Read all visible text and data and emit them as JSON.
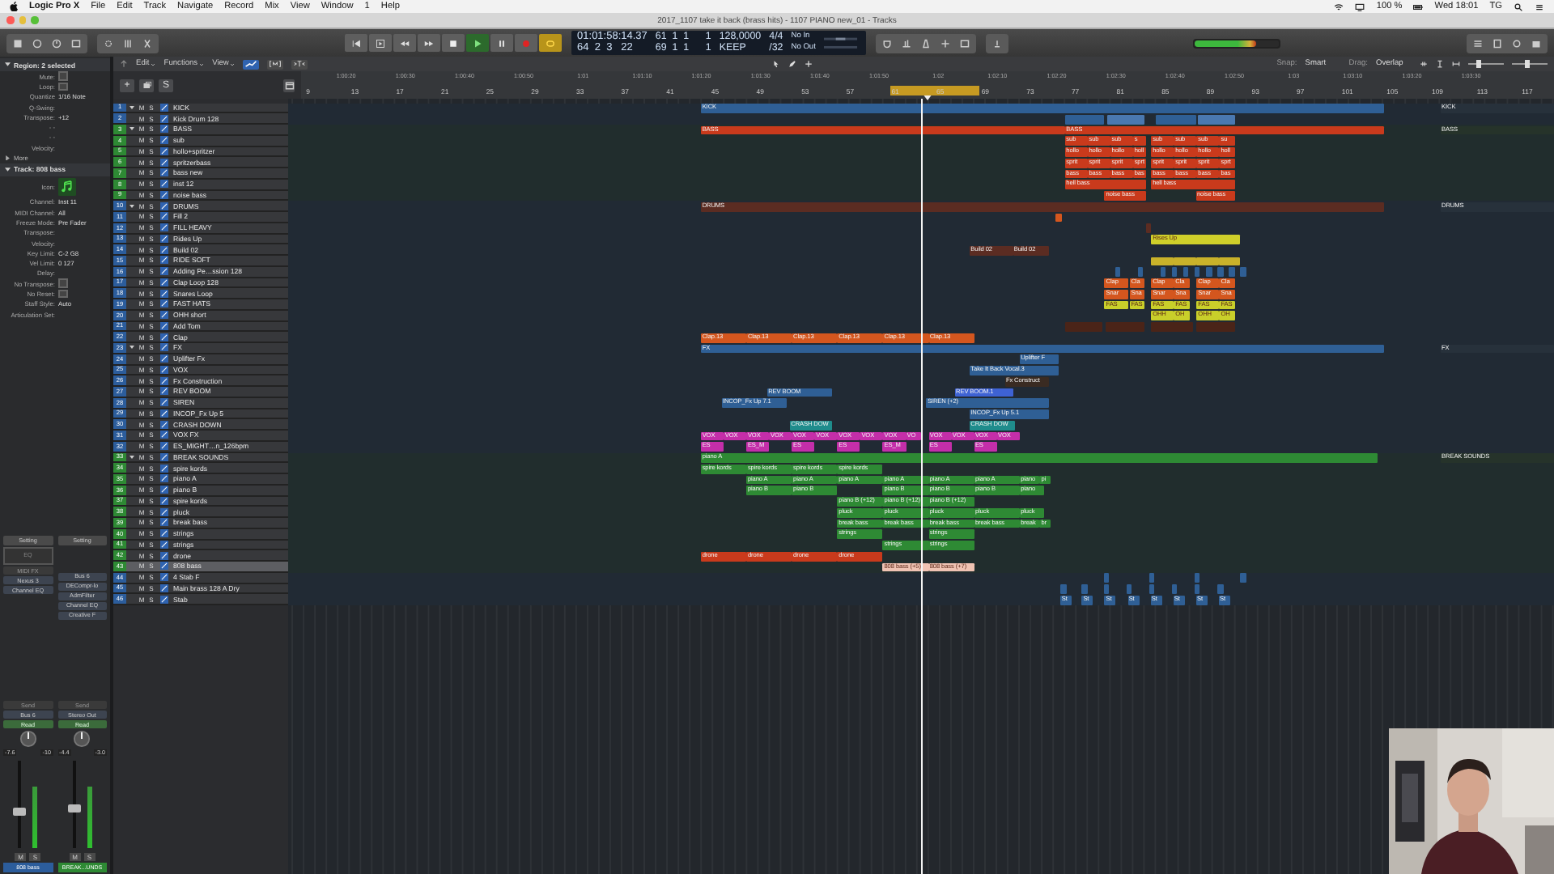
{
  "menubar": {
    "app": "Logic Pro X",
    "menus": [
      "File",
      "Edit",
      "Track",
      "Navigate",
      "Record",
      "Mix",
      "View",
      "Window",
      "1",
      "Help"
    ],
    "status": [
      "100 %",
      "Wed 18:01",
      "TG"
    ]
  },
  "window": {
    "title": "2017_1107 take it back (brass hits) - 1107 PIANO new_01 - Tracks"
  },
  "transport": {
    "playing": true,
    "cycle_on": true,
    "recording": false,
    "time": "01:01:58:14.37",
    "bars": "64  2  3   22",
    "cycle_start": "61  1  1      1",
    "cycle_end": "69  1  1      1",
    "tempo": "128,0000",
    "keep": "KEEP",
    "signature": "4/4",
    "division": "/32",
    "midi_in": "No In",
    "midi_out": "No Out"
  },
  "master_volume": {
    "level": 0.73
  },
  "toolbar": {
    "menus": [
      "Edit",
      "Functions",
      "View"
    ],
    "snap_label": "Snap:",
    "snap": "Smart",
    "drag_label": "Drag:",
    "drag": "Overlap",
    "zoom_sliders": [
      {
        "level": 0.3
      },
      {
        "level": 0.45
      }
    ]
  },
  "track_header": {
    "add": "+",
    "solo": "S"
  },
  "ruler": {
    "times": [
      "1:00:20",
      "1:00:30",
      "1:00:40",
      "1:00:50",
      "1:01",
      "1:01:10",
      "1:01:20",
      "1:01:30",
      "1:01:40",
      "1:01:50",
      "1:02",
      "1:02:10",
      "1:02:20",
      "1:02:30",
      "1:02:40",
      "1:02:50",
      "1:03",
      "1:03:10",
      "1:03:20",
      "1:03:30"
    ],
    "bars": [
      "9",
      "13",
      "17",
      "21",
      "25",
      "29",
      "33",
      "37",
      "41",
      "45",
      "49",
      "53",
      "57",
      "61",
      "65",
      "69",
      "73",
      "77",
      "81",
      "85",
      "89",
      "93",
      "97",
      "101",
      "105",
      "109",
      "113",
      "117"
    ]
  },
  "inspector": {
    "region": {
      "title": "Region: 2 selected",
      "fields": [
        {
          "label": "Mute:",
          "kind": "checkbox",
          "checked": false
        },
        {
          "label": "Loop:",
          "kind": "checkbox",
          "checked": false
        },
        {
          "label": "Quantize",
          "kind": "value",
          "value": "1/16 Note"
        },
        {
          "label": "Q-Swing:",
          "kind": "value"
        },
        {
          "label": "Transpose:",
          "kind": "value",
          "value": "+12"
        },
        {
          "label": "- -",
          "kind": "value"
        },
        {
          "label": "- -",
          "kind": "value"
        },
        {
          "label": "Velocity:",
          "kind": "value"
        }
      ],
      "more": "More"
    },
    "track": {
      "title": "Track: 808 bass",
      "fields": [
        {
          "label": "Icon:",
          "kind": "icon"
        },
        {
          "label": "Channel:",
          "kind": "value",
          "value": "Inst 11"
        },
        {
          "label": "MIDI Channel:",
          "kind": "value",
          "value": "All"
        },
        {
          "label": "Freeze Mode:",
          "kind": "value",
          "value": "Pre Fader"
        },
        {
          "label": "Transpose:",
          "kind": "value"
        },
        {
          "label": "Velocity:",
          "kind": "value"
        },
        {
          "label": "Key Limit:",
          "kind": "value",
          "value": "C-2  G8"
        },
        {
          "label": "Vel Limit:",
          "kind": "value",
          "value": "0  127"
        },
        {
          "label": "Delay:",
          "kind": "value"
        },
        {
          "label": "No Transpose:",
          "kind": "checkbox",
          "checked": false
        },
        {
          "label": "No Reset:",
          "kind": "checkbox",
          "checked": false
        },
        {
          "label": "Staff Style:",
          "kind": "value",
          "value": "Auto"
        },
        {
          "label": "Articulation Set:",
          "kind": "value"
        }
      ]
    },
    "strips": [
      {
        "setting": "Setting",
        "eq": "EQ",
        "midi_fx": "MIDI FX",
        "inserts": [
          "Nexus 3",
          "Channel EQ"
        ],
        "send": "Send",
        "output": "Bus 6",
        "automation": "Read",
        "readings": [
          "-7.6",
          "-10"
        ],
        "level": 0.38,
        "mute": "M",
        "solo": "S",
        "name": "808 bass",
        "color": "#2c5d9c"
      },
      {
        "setting": "Setting",
        "inserts": [
          "Bus 6",
          "DECompr-lo",
          "AdmFilter",
          "Channel EQ",
          "Creative F"
        ],
        "send": "Send",
        "output": "Stereo Out",
        "automation": "Read",
        "readings": [
          "-4.4",
          "-3.0"
        ],
        "level": 0.42,
        "mute": "M",
        "solo": "S",
        "name": "BREAK...UNDS",
        "color": "#2e8a34"
      }
    ]
  },
  "tracks": [
    {
      "num": "1",
      "name": "KICK",
      "color": "#2c5d9c",
      "kind": "folder",
      "selected": false,
      "mute": "M",
      "solo": "S",
      "regions": [
        {
          "label": "KICK",
          "color": "#2f5f95"
        },
        {
          "label": "KICK",
          "color": "#27313b"
        }
      ]
    },
    {
      "num": "2",
      "name": "Kick Drum 128",
      "color": "#2c5d9c",
      "kind": "track",
      "selected": false,
      "mute": "M",
      "solo": "S",
      "regions": [
        {
          "color": "#2f5f95"
        },
        {
          "color": "#4a78b0"
        },
        {
          "color": "#2f5f95"
        },
        {
          "color": "#4a78b0"
        }
      ]
    },
    {
      "num": "3",
      "name": "BASS",
      "color": "#2e8a34",
      "kind": "folder",
      "selected": false,
      "mute": "M",
      "solo": "S",
      "regions": [
        {
          "label": "BASS",
          "color": "#c93a1c"
        },
        {
          "label": "BASS",
          "color": "#c93a1c"
        },
        {
          "label": "BASS",
          "color": "#26332a"
        }
      ]
    },
    {
      "num": "4",
      "name": "sub",
      "color": "#2e8a34",
      "kind": "track",
      "selected": false,
      "mute": "M",
      "solo": "S",
      "regions": [
        {
          "label": "sub",
          "color": "#c93a1c"
        },
        {
          "label": "sub",
          "color": "#c93a1c"
        },
        {
          "label": "sub",
          "color": "#c93a1c"
        },
        {
          "label": "s",
          "color": "#c93a1c"
        },
        {
          "label": "sub",
          "color": "#c93a1c"
        },
        {
          "label": "sub",
          "color": "#c93a1c"
        },
        {
          "label": "sub",
          "color": "#c93a1c"
        },
        {
          "label": "su",
          "color": "#c93a1c"
        }
      ]
    },
    {
      "num": "5",
      "name": "hollo+spritzer",
      "color": "#2e8a34",
      "kind": "track",
      "selected": false,
      "mute": "M",
      "solo": "S",
      "regions": [
        {
          "label": "hollo",
          "color": "#c93a1c"
        },
        {
          "label": "hollo",
          "color": "#c93a1c"
        },
        {
          "label": "hollo",
          "color": "#c93a1c"
        },
        {
          "label": "holl",
          "color": "#c93a1c"
        },
        {
          "label": "hollo",
          "color": "#c93a1c"
        },
        {
          "label": "hollo",
          "color": "#c93a1c"
        },
        {
          "label": "hollo",
          "color": "#c93a1c"
        },
        {
          "label": "holl",
          "color": "#c93a1c"
        }
      ]
    },
    {
      "num": "6",
      "name": "spritzerbass",
      "color": "#2e8a34",
      "kind": "track",
      "selected": false,
      "mute": "M",
      "solo": "S",
      "regions": [
        {
          "label": "sprit",
          "color": "#c93a1c"
        },
        {
          "label": "sprit",
          "color": "#c93a1c"
        },
        {
          "label": "sprit",
          "color": "#c93a1c"
        },
        {
          "label": "sprt",
          "color": "#c93a1c"
        },
        {
          "label": "sprit",
          "color": "#c93a1c"
        },
        {
          "label": "sprit",
          "color": "#c93a1c"
        },
        {
          "label": "sprit",
          "color": "#c93a1c"
        },
        {
          "label": "sprt",
          "color": "#c93a1c"
        }
      ]
    },
    {
      "num": "7",
      "name": "bass new",
      "color": "#2e8a34",
      "kind": "track",
      "selected": false,
      "mute": "M",
      "solo": "S",
      "regions": [
        {
          "label": "bass",
          "color": "#c93a1c"
        },
        {
          "label": "bass",
          "color": "#c93a1c"
        },
        {
          "label": "bass",
          "color": "#c93a1c"
        },
        {
          "label": "bas",
          "color": "#c93a1c"
        },
        {
          "label": "bass",
          "color": "#c93a1c"
        },
        {
          "label": "bass",
          "color": "#c93a1c"
        },
        {
          "label": "bass",
          "color": "#c93a1c"
        },
        {
          "label": "bas",
          "color": "#c93a1c"
        }
      ]
    },
    {
      "num": "8",
      "name": "inst 12",
      "color": "#2e8a34",
      "kind": "track",
      "selected": false,
      "mute": "M",
      "solo": "S",
      "regions": [
        {
          "label": "hell bass",
          "color": "#c93a1c"
        },
        {
          "label": "hell bass",
          "color": "#c93a1c"
        }
      ]
    },
    {
      "num": "9",
      "name": "noise bass",
      "color": "#2e8a34",
      "kind": "track",
      "selected": false,
      "mute": "M",
      "solo": "S",
      "regions": [
        {
          "label": "noise bass",
          "color": "#c93a1c"
        },
        {
          "label": "noise bass",
          "color": "#c93a1c"
        }
      ]
    },
    {
      "num": "10",
      "name": "DRUMS",
      "color": "#2c5d9c",
      "kind": "folder",
      "selected": false,
      "mute": "M",
      "solo": "S",
      "regions": [
        {
          "label": "DRUMS",
          "color": "#5b2c22"
        },
        {
          "label": "DRUMS",
          "color": "#27313b"
        }
      ]
    },
    {
      "num": "11",
      "name": "Fill 2",
      "color": "#2c5d9c",
      "kind": "track",
      "selected": false,
      "mute": "M",
      "solo": "S",
      "regions": [
        {
          "color": "#d4561e"
        }
      ]
    },
    {
      "num": "12",
      "name": "FILL HEAVY",
      "color": "#2c5d9c",
      "kind": "track",
      "selected": false,
      "mute": "M",
      "solo": "S",
      "regions": [
        {
          "color": "#5b2c22"
        }
      ]
    },
    {
      "num": "13",
      "name": "Rides Up",
      "color": "#2c5d9c",
      "kind": "track",
      "selected": false,
      "mute": "M",
      "solo": "S",
      "regions": [
        {
          "label": "Rises Up",
          "color": "#cfcf2a"
        }
      ]
    },
    {
      "num": "14",
      "name": "Build 02",
      "color": "#2c5d9c",
      "kind": "track",
      "selected": false,
      "mute": "M",
      "solo": "S",
      "regions": [
        {
          "label": "Build 02",
          "color": "#5b2c22"
        },
        {
          "label": "Build 02",
          "color": "#5b2c22"
        }
      ]
    },
    {
      "num": "15",
      "name": "RIDE SOFT",
      "color": "#2c5d9c",
      "kind": "track",
      "selected": false,
      "mute": "M",
      "solo": "S",
      "regions": [
        {
          "color": "#c9b22a"
        },
        {
          "color": "#c9b22a"
        },
        {
          "color": "#c9b22a"
        },
        {
          "color": "#c9b22a"
        }
      ]
    },
    {
      "num": "16",
      "name": "Adding Pe…ssion 128",
      "color": "#2c5d9c",
      "kind": "track",
      "selected": false,
      "mute": "M",
      "solo": "S",
      "regions": [
        {
          "color": "#2f5f95"
        },
        {
          "color": "#2f5f95"
        },
        {
          "color": "#2f5f95"
        },
        {
          "color": "#2f5f95"
        },
        {
          "color": "#2f5f95"
        },
        {
          "color": "#2f5f95"
        },
        {
          "color": "#2f5f95"
        },
        {
          "color": "#2f5f95"
        },
        {
          "color": "#2f5f95"
        },
        {
          "color": "#2f5f95"
        }
      ]
    },
    {
      "num": "17",
      "name": "Clap Loop 128",
      "color": "#2c5d9c",
      "kind": "track",
      "selected": false,
      "mute": "M",
      "solo": "S",
      "regions": [
        {
          "label": "Clap",
          "color": "#d4561e"
        },
        {
          "label": "Cla",
          "color": "#d4561e"
        },
        {
          "label": "Clap",
          "color": "#d4561e"
        },
        {
          "label": "Cla",
          "color": "#d4561e"
        },
        {
          "label": "Clap",
          "color": "#d4561e"
        },
        {
          "label": "Cla",
          "color": "#d4561e"
        }
      ]
    },
    {
      "num": "18",
      "name": "Snares Loop",
      "color": "#2c5d9c",
      "kind": "track",
      "selected": false,
      "mute": "M",
      "solo": "S",
      "regions": [
        {
          "label": "Snar",
          "color": "#d4561e"
        },
        {
          "label": "Sna",
          "color": "#d4561e"
        },
        {
          "label": "Snar",
          "color": "#d4561e"
        },
        {
          "label": "Sna",
          "color": "#d4561e"
        },
        {
          "label": "Snar",
          "color": "#d4561e"
        },
        {
          "label": "Sna",
          "color": "#d4561e"
        }
      ]
    },
    {
      "num": "19",
      "name": "FAST HATS",
      "color": "#2c5d9c",
      "kind": "track",
      "selected": false,
      "mute": "M",
      "solo": "S",
      "regions": [
        {
          "label": "FAS",
          "color": "#c9cf2a"
        },
        {
          "label": "FAS",
          "color": "#c9cf2a"
        },
        {
          "label": "FAS",
          "color": "#c9cf2a"
        },
        {
          "label": "FAS",
          "color": "#c9cf2a"
        },
        {
          "label": "FAS",
          "color": "#c9cf2a"
        },
        {
          "label": "FAS",
          "color": "#c9cf2a"
        }
      ]
    },
    {
      "num": "20",
      "name": "OHH short",
      "color": "#2c5d9c",
      "kind": "track",
      "selected": false,
      "mute": "M",
      "solo": "S",
      "regions": [
        {
          "label": "OHH",
          "color": "#c9cf2a"
        },
        {
          "label": "OH",
          "color": "#c9cf2a"
        },
        {
          "label": "OHH",
          "color": "#c9cf2a"
        },
        {
          "label": "OH",
          "color": "#c9cf2a"
        }
      ]
    },
    {
      "num": "21",
      "name": "Add Tom",
      "color": "#2c5d9c",
      "kind": "track",
      "selected": false,
      "mute": "M",
      "solo": "S",
      "regions": [
        {
          "color": "#4a2418"
        },
        {
          "color": "#4a2418"
        },
        {
          "color": "#4a2418"
        },
        {
          "color": "#4a2418"
        }
      ]
    },
    {
      "num": "22",
      "name": "Clap",
      "color": "#2c5d9c",
      "kind": "track",
      "selected": false,
      "mute": "M",
      "solo": "S",
      "regions": [
        {
          "label": "Clap.13",
          "color": "#d4561e"
        },
        {
          "label": "Clap.13",
          "color": "#d4561e"
        },
        {
          "label": "Clap.13",
          "color": "#d4561e"
        },
        {
          "label": "Clap.13",
          "color": "#d4561e"
        },
        {
          "label": "Clap.13",
          "color": "#d4561e"
        },
        {
          "label": "Clap.13",
          "color": "#d4561e"
        }
      ]
    },
    {
      "num": "23",
      "name": "FX",
      "color": "#2c5d9c",
      "kind": "folder",
      "selected": false,
      "mute": "M",
      "solo": "S",
      "regions": [
        {
          "label": "FX",
          "color": "#2f5f95"
        },
        {
          "label": "FX",
          "color": "#27313b"
        }
      ]
    },
    {
      "num": "24",
      "name": "Uplifter Fx",
      "color": "#2c5d9c",
      "kind": "track",
      "selected": false,
      "mute": "M",
      "solo": "S",
      "regions": [
        {
          "label": "Uplifter F",
          "color": "#2f5f95"
        }
      ]
    },
    {
      "num": "25",
      "name": "VOX",
      "color": "#2c5d9c",
      "kind": "track",
      "selected": false,
      "mute": "M",
      "solo": "S",
      "regions": [
        {
          "label": "Take It Back Vocal.3",
          "color": "#2f5f95"
        }
      ]
    },
    {
      "num": "26",
      "name": "Fx Construction",
      "color": "#2c5d9c",
      "kind": "track",
      "selected": false,
      "mute": "M",
      "solo": "S",
      "regions": [
        {
          "label": "Fx Construct",
          "color": "#3a2b22"
        }
      ]
    },
    {
      "num": "27",
      "name": "REV BOOM",
      "color": "#2c5d9c",
      "kind": "track",
      "selected": false,
      "mute": "M",
      "solo": "S",
      "regions": [
        {
          "label": "REV BOOM",
          "color": "#2f5f95"
        },
        {
          "label": "REV BOOM.1",
          "color": "#3e62d4"
        }
      ]
    },
    {
      "num": "28",
      "name": "SIREN",
      "color": "#2c5d9c",
      "kind": "track",
      "selected": false,
      "mute": "M",
      "solo": "S",
      "regions": [
        {
          "label": "INCOP_Fx Up 7.1",
          "color": "#2f5f95"
        },
        {
          "label": "SIREN (+2)",
          "color": "#2f5f95"
        }
      ]
    },
    {
      "num": "29",
      "name": "INCOP_Fx Up 5",
      "color": "#2c5d9c",
      "kind": "track",
      "selected": false,
      "mute": "M",
      "solo": "S",
      "regions": [
        {
          "label": "INCOP_Fx Up 5.1",
          "color": "#2f5f95"
        }
      ]
    },
    {
      "num": "30",
      "name": "CRASH DOWN",
      "color": "#2c5d9c",
      "kind": "track",
      "selected": false,
      "mute": "M",
      "solo": "S",
      "regions": [
        {
          "label": "CRASH DOW",
          "color": "#1f8c8c"
        },
        {
          "label": "CRASH DOW",
          "color": "#1f8c8c"
        }
      ]
    },
    {
      "num": "31",
      "name": "VOX FX",
      "color": "#2c5d9c",
      "kind": "track",
      "selected": false,
      "mute": "M",
      "solo": "S",
      "regions": [
        {
          "label": "VOX",
          "color": "#c42ea9"
        },
        {
          "label": "VOX",
          "color": "#c42ea9"
        },
        {
          "label": "VOX",
          "color": "#c42ea9"
        },
        {
          "label": "VOX",
          "color": "#c42ea9"
        },
        {
          "label": "VOX",
          "color": "#c42ea9"
        },
        {
          "label": "VOX",
          "color": "#c42ea9"
        },
        {
          "label": "VOX",
          "color": "#c42ea9"
        },
        {
          "label": "VOX",
          "color": "#c42ea9"
        },
        {
          "label": "VOX",
          "color": "#c42ea9"
        },
        {
          "label": "VO",
          "color": "#c42ea9"
        },
        {
          "label": "VOX",
          "color": "#c42ea9"
        },
        {
          "label": "VOX",
          "color": "#c42ea9"
        },
        {
          "label": "VOX",
          "color": "#c42ea9"
        },
        {
          "label": "VOX",
          "color": "#c42ea9"
        }
      ]
    },
    {
      "num": "32",
      "name": "ES_MIGHT…n_126bpm",
      "color": "#2c5d9c",
      "kind": "track",
      "selected": false,
      "mute": "M",
      "solo": "S",
      "regions": [
        {
          "label": "ES",
          "color": "#c42ea9"
        },
        {
          "label": "ES_M",
          "color": "#c42ea9"
        },
        {
          "label": "ES",
          "color": "#c42ea9"
        },
        {
          "label": "ES",
          "color": "#c42ea9"
        },
        {
          "label": "ES_M",
          "color": "#c42ea9"
        },
        {
          "label": "ES",
          "color": "#c42ea9"
        },
        {
          "label": "ES",
          "color": "#c42ea9"
        }
      ]
    },
    {
      "num": "33",
      "name": "BREAK SOUNDS",
      "color": "#2e8a34",
      "kind": "folder",
      "selected": false,
      "mute": "M",
      "solo": "S",
      "regions": [
        {
          "label": "piano A",
          "color": "#2e8a34"
        },
        {
          "label": "BREAK SOUNDS",
          "color": "#26332a"
        }
      ]
    },
    {
      "num": "34",
      "name": "spire kords",
      "color": "#2e8a34",
      "kind": "track",
      "selected": false,
      "mute": "M",
      "solo": "S",
      "regions": [
        {
          "label": "spire kords",
          "color": "#2e8a34"
        },
        {
          "label": "spire kords",
          "color": "#2e8a34"
        },
        {
          "label": "spire kords",
          "color": "#2e8a34"
        },
        {
          "label": "spire kords",
          "color": "#2e8a34"
        }
      ]
    },
    {
      "num": "35",
      "name": "piano A",
      "color": "#2e8a34",
      "kind": "track",
      "selected": false,
      "mute": "M",
      "solo": "S",
      "regions": [
        {
          "label": "piano A",
          "color": "#2e8a34"
        },
        {
          "label": "piano A",
          "color": "#2e8a34"
        },
        {
          "label": "piano A",
          "color": "#2e8a34"
        },
        {
          "label": "piano A",
          "color": "#2e8a34"
        },
        {
          "label": "piano A",
          "color": "#2e8a34"
        },
        {
          "label": "piano A",
          "color": "#2e8a34"
        },
        {
          "label": "piano",
          "color": "#2e8a34"
        },
        {
          "label": "pi",
          "color": "#2e8a34"
        }
      ]
    },
    {
      "num": "36",
      "name": "piano B",
      "color": "#2e8a34",
      "kind": "track",
      "selected": false,
      "mute": "M",
      "solo": "S",
      "regions": [
        {
          "label": "piano B",
          "color": "#2e8a34"
        },
        {
          "label": "piano B",
          "color": "#2e8a34"
        },
        {
          "label": "piano B",
          "color": "#2e8a34"
        },
        {
          "label": "piano B",
          "color": "#2e8a34"
        },
        {
          "label": "piano B",
          "color": "#2e8a34"
        },
        {
          "label": "piano",
          "color": "#2e8a34"
        }
      ]
    },
    {
      "num": "37",
      "name": "spire kords",
      "color": "#2e8a34",
      "kind": "track",
      "selected": false,
      "mute": "M",
      "solo": "S",
      "regions": [
        {
          "label": "piano B (+12)",
          "color": "#2e8a34"
        },
        {
          "label": "piano B (+12)",
          "color": "#2e8a34"
        },
        {
          "label": "piano B (+12)",
          "color": "#2e8a34"
        }
      ]
    },
    {
      "num": "38",
      "name": "pluck",
      "color": "#2e8a34",
      "kind": "track",
      "selected": false,
      "mute": "M",
      "solo": "S",
      "regions": [
        {
          "label": "pluck",
          "color": "#2e8a34"
        },
        {
          "label": "pluck",
          "color": "#2e8a34"
        },
        {
          "label": "pluck",
          "color": "#2e8a34"
        },
        {
          "label": "pluck",
          "color": "#2e8a34"
        },
        {
          "label": "pluck",
          "color": "#2e8a34"
        }
      ]
    },
    {
      "num": "39",
      "name": "break bass",
      "color": "#2e8a34",
      "kind": "track",
      "selected": false,
      "mute": "M",
      "solo": "S",
      "regions": [
        {
          "label": "break bass",
          "color": "#2e8a34"
        },
        {
          "label": "break bass",
          "color": "#2e8a34"
        },
        {
          "label": "break bass",
          "color": "#2e8a34"
        },
        {
          "label": "break bass",
          "color": "#2e8a34"
        },
        {
          "label": "break",
          "color": "#2e8a34"
        },
        {
          "label": "br",
          "color": "#2e8a34"
        }
      ]
    },
    {
      "num": "40",
      "name": "strings",
      "color": "#2e8a34",
      "kind": "track",
      "selected": false,
      "mute": "M",
      "solo": "S",
      "regions": [
        {
          "label": "strings",
          "color": "#2e8a34"
        },
        {
          "label": "strings",
          "color": "#2e8a34"
        }
      ]
    },
    {
      "num": "41",
      "name": "strings",
      "color": "#2e8a34",
      "kind": "track",
      "selected": false,
      "mute": "M",
      "solo": "S",
      "regions": [
        {
          "label": "strings",
          "color": "#2e8a34"
        },
        {
          "label": "strings",
          "color": "#2e8a34"
        }
      ]
    },
    {
      "num": "42",
      "name": "drone",
      "color": "#2e8a34",
      "kind": "track",
      "selected": false,
      "mute": "M",
      "solo": "S",
      "regions": [
        {
          "label": "drone",
          "color": "#c93a1c"
        },
        {
          "label": "drone",
          "color": "#c93a1c"
        },
        {
          "label": "drone",
          "color": "#c93a1c"
        },
        {
          "label": "drone",
          "color": "#c93a1c"
        }
      ]
    },
    {
      "num": "43",
      "name": "808 bass",
      "color": "#2e8a34",
      "kind": "track",
      "selected": true,
      "mute": "M",
      "solo": "S",
      "regions": [
        {
          "label": "808 bass (+5)",
          "color": "#f0c3b3"
        },
        {
          "label": "808 bass (+7)",
          "color": "#f0c3b3"
        }
      ]
    },
    {
      "num": "44",
      "name": "4 Stab F",
      "color": "#2c5d9c",
      "kind": "track",
      "selected": false,
      "mute": "M",
      "solo": "S",
      "regions": [
        {
          "color": "#2f5f95"
        },
        {
          "color": "#2f5f95"
        },
        {
          "color": "#2f5f95"
        },
        {
          "color": "#2f5f95"
        }
      ]
    },
    {
      "num": "45",
      "name": "Main brass 128 A Dry",
      "color": "#2c5d9c",
      "kind": "track",
      "selected": false,
      "mute": "M",
      "solo": "S",
      "regions": [
        {
          "color": "#2f5f95"
        },
        {
          "color": "#2f5f95"
        },
        {
          "color": "#2f5f95"
        },
        {
          "color": "#2f5f95"
        },
        {
          "color": "#2f5f95"
        },
        {
          "color": "#2f5f95"
        },
        {
          "color": "#2f5f95"
        },
        {
          "color": "#2f5f95"
        }
      ]
    },
    {
      "num": "46",
      "name": "Stab",
      "color": "#2c5d9c",
      "kind": "track",
      "selected": false,
      "mute": "M",
      "solo": "S",
      "regions": [
        {
          "label": "St",
          "color": "#2f5f95"
        },
        {
          "label": "St",
          "color": "#2f5f95"
        },
        {
          "label": "St",
          "color": "#2f5f95"
        },
        {
          "label": "St",
          "color": "#2f5f95"
        },
        {
          "label": "St",
          "color": "#2f5f95"
        },
        {
          "label": "St",
          "color": "#2f5f95"
        },
        {
          "label": "St",
          "color": "#2f5f95"
        },
        {
          "label": "St",
          "color": "#2f5f95"
        }
      ]
    }
  ]
}
